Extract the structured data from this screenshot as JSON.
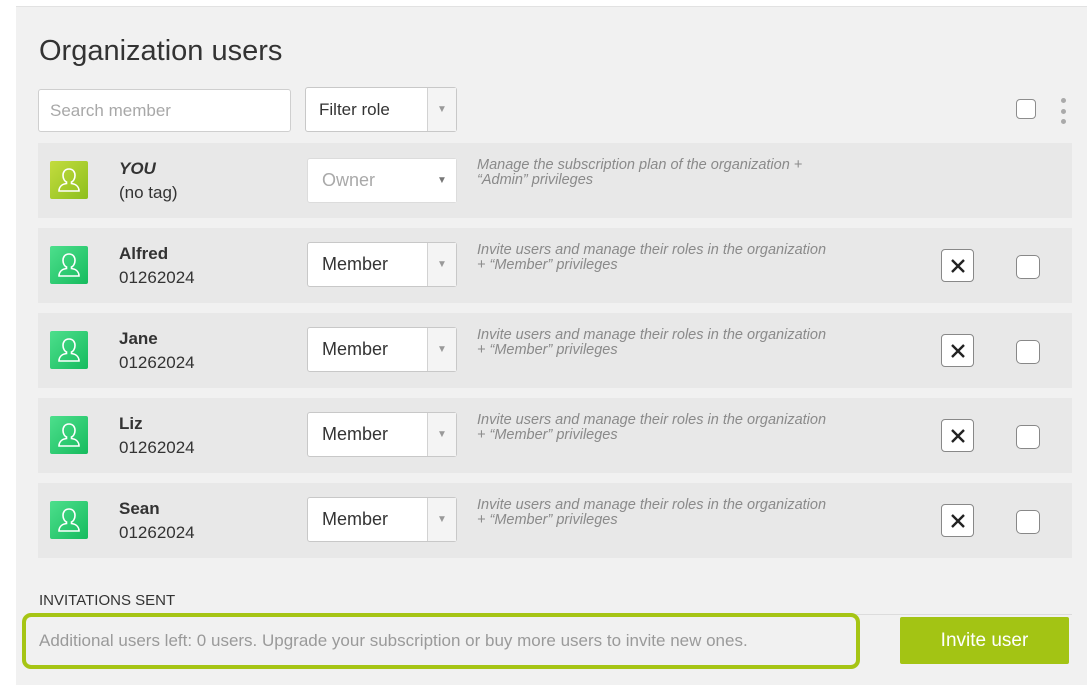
{
  "page": {
    "title": "Organization users"
  },
  "toolbar": {
    "search_placeholder": "Search member",
    "filter_label": "Filter role"
  },
  "owner": {
    "name": "YOU",
    "tag": "(no tag)",
    "role": "Owner",
    "description_line1": "Manage the subscription plan of the organization +",
    "description_line2": "“Admin” privileges"
  },
  "members": [
    {
      "name": "Alfred",
      "tag": "01262024",
      "role": "Member",
      "description_line1": "Invite users and manage their roles in the organization",
      "description_line2": "+ “Member” privileges"
    },
    {
      "name": "Jane",
      "tag": "01262024",
      "role": "Member",
      "description_line1": "Invite users and manage their roles in the organization",
      "description_line2": "+ “Member” privileges"
    },
    {
      "name": "Liz",
      "tag": "01262024",
      "role": "Member",
      "description_line1": "Invite users and manage their roles in the organization",
      "description_line2": "+ “Member” privileges"
    },
    {
      "name": "Sean",
      "tag": "01262024",
      "role": "Member",
      "description_line1": "Invite users and manage their roles in the organization",
      "description_line2": "+ “Member” privileges"
    }
  ],
  "invitations": {
    "heading": "INVITATIONS SENT",
    "notice": "Additional users left: 0 users. Upgrade your subscription or buy more users to invite new ones.",
    "invite_button": "Invite user"
  },
  "colors": {
    "accent": "#a3c414",
    "avatar_owner": "#a6cc2a",
    "avatar_member": "#2ccc73"
  },
  "icons": {
    "avatar": "user-outline-icon",
    "remove": "close-icon",
    "menu": "kebab-menu-icon",
    "dropdown": "caret-down-icon"
  }
}
